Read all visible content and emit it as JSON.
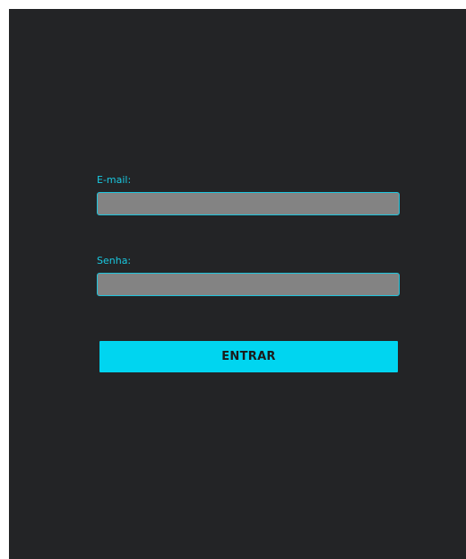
{
  "login_form": {
    "email_label": "E-mail:",
    "email_value": "",
    "email_placeholder": "",
    "password_label": "Senha:",
    "password_value": "",
    "password_placeholder": "",
    "submit_label": "ENTRAR"
  },
  "colors": {
    "background": "#232426",
    "accent": "#00d5f0",
    "input_fill": "#838383"
  }
}
